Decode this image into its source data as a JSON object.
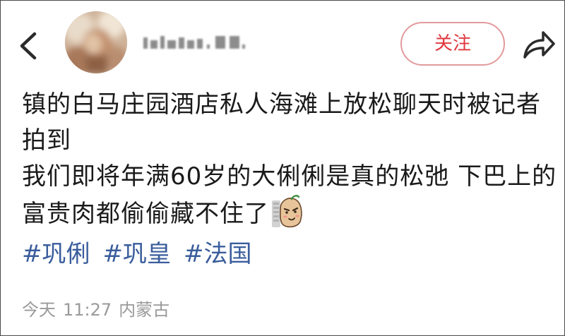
{
  "header": {
    "username": "▎█▇▆█ ▇▆",
    "follow_label": "关注"
  },
  "post": {
    "lines": [
      "镇的白马庄园酒店私人海滩上放松聊天时被记者",
      "拍到",
      "我们即将年满60岁的大俐俐是真的松弛 下巴上的",
      "富贵肉都偷偷藏不住了"
    ],
    "sticker": "sly-potato-sticker",
    "hashtags": [
      "#巩俐",
      "#巩皇",
      "#法国"
    ]
  },
  "meta": {
    "day": "今天",
    "time": "11:27",
    "location": "内蒙古"
  },
  "colors": {
    "accent": "#e0383e",
    "hashtag": "#3a5d9c",
    "meta": "#9a9a9a"
  },
  "icons": {
    "back": "back-chevron-icon",
    "share": "share-arrow-icon"
  }
}
